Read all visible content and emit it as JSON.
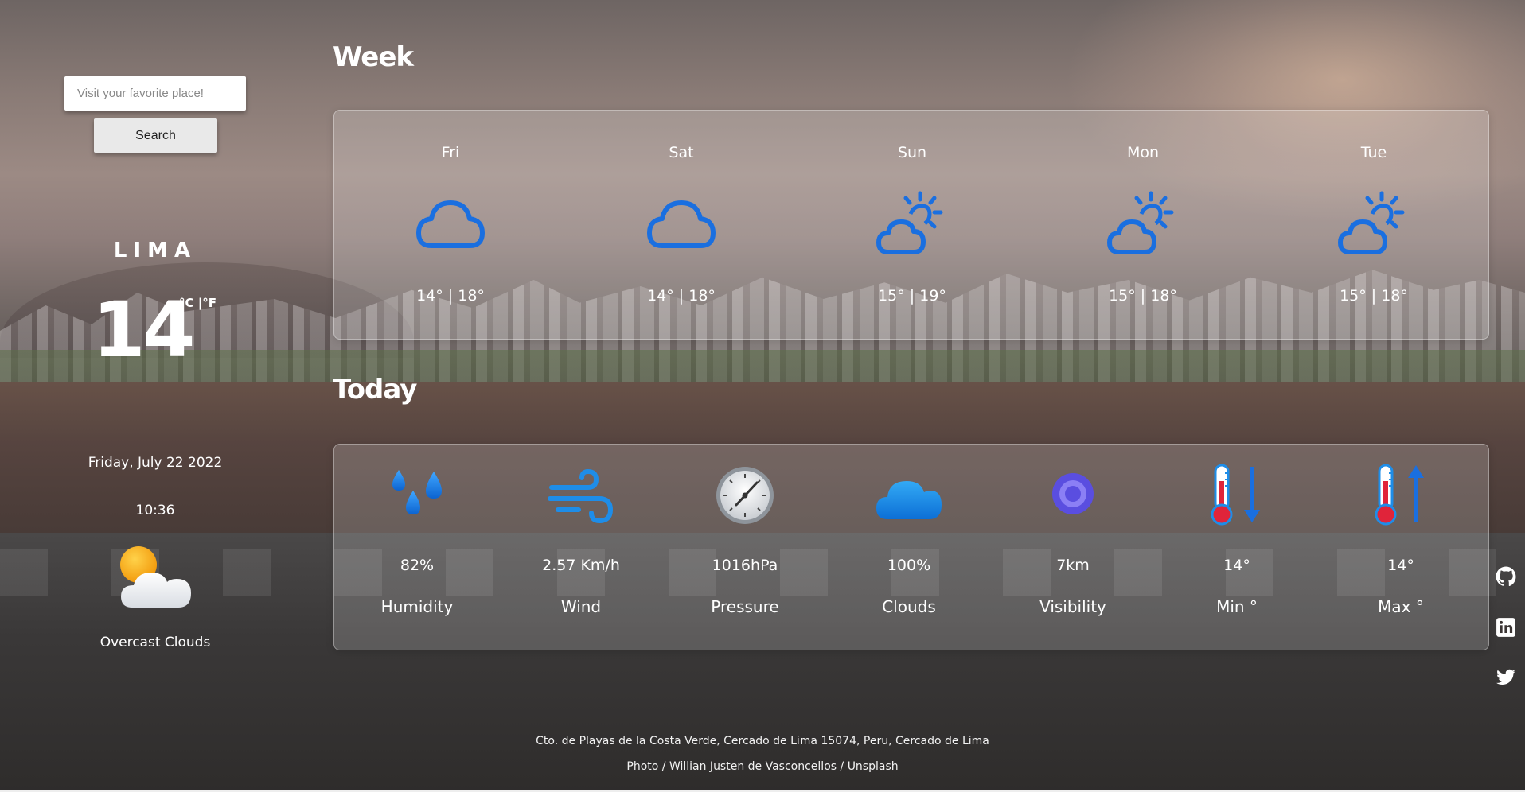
{
  "search": {
    "placeholder": "Visit your favorite place!",
    "button_label": "Search"
  },
  "current": {
    "city": "LIMA",
    "temperature": "14",
    "unit_toggle": "°C |°F",
    "date": "Friday, July 22 2022",
    "time": "10:36",
    "icon": "partly-cloudy-sun-icon",
    "description": "Overcast Clouds"
  },
  "week": {
    "title": "Week",
    "days": [
      {
        "name": "Fri",
        "icon": "cloud-icon",
        "temps": "14° | 18°"
      },
      {
        "name": "Sat",
        "icon": "cloud-icon",
        "temps": "14° | 18°"
      },
      {
        "name": "Sun",
        "icon": "partly-sunny-icon",
        "temps": "15° | 19°"
      },
      {
        "name": "Mon",
        "icon": "partly-sunny-icon",
        "temps": "15° | 18°"
      },
      {
        "name": "Tue",
        "icon": "partly-sunny-icon",
        "temps": "15° | 18°"
      }
    ]
  },
  "today": {
    "title": "Today",
    "metrics": [
      {
        "label": "Humidity",
        "value": "82%",
        "icon": "humidity-drops-icon"
      },
      {
        "label": "Wind",
        "value": "2.57 Km/h",
        "icon": "wind-icon"
      },
      {
        "label": "Pressure",
        "value": "1016hPa",
        "icon": "pressure-gauge-icon"
      },
      {
        "label": "Clouds",
        "value": "100%",
        "icon": "cloud-icon"
      },
      {
        "label": "Visibility",
        "value": "7km",
        "icon": "visibility-icon"
      },
      {
        "label": "Min °",
        "value": "14°",
        "icon": "thermometer-down-icon"
      },
      {
        "label": "Max °",
        "value": "14°",
        "icon": "thermometer-up-icon"
      }
    ]
  },
  "social": [
    "github-icon",
    "linkedin-icon",
    "twitter-icon"
  ],
  "footer": {
    "address": "Cto. de Playas de la Costa Verde, Cercado de Lima 15074, Peru, Cercado de Lima",
    "photo_label": "Photo",
    "author": "Willian Justen de Vasconcellos",
    "source": "Unsplash",
    "separator": "/"
  },
  "colors": {
    "icon_blue": "#1a6fe0",
    "accent_red": "#e0243a"
  }
}
